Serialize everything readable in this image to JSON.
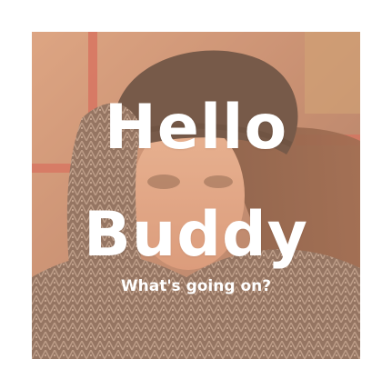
{
  "card": {
    "title_line_1": "Hello",
    "title_line_2": "Buddy",
    "subtitle": "What's going on?"
  },
  "colors": {
    "page_background": "#ffffff",
    "text": "#ffffff",
    "photo_tint": "#e6aa82"
  }
}
